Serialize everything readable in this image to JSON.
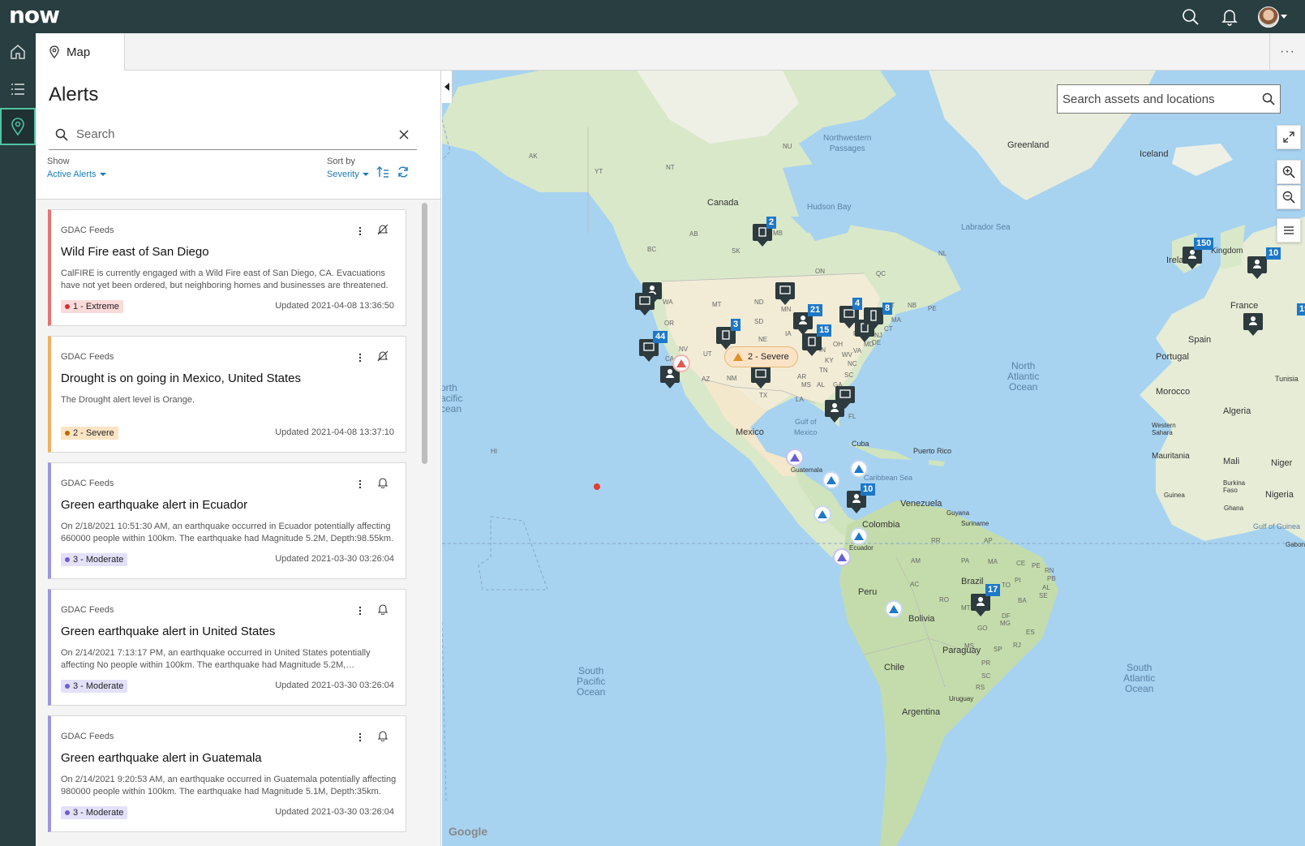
{
  "app": {
    "logo_text": "now",
    "tab_label": "Map",
    "tab_more": "···"
  },
  "panel": {
    "title": "Alerts",
    "search_placeholder": "Search",
    "show_label": "Show",
    "show_value": "Active Alerts",
    "sort_label": "Sort by",
    "sort_value": "Severity"
  },
  "alerts": [
    {
      "source": "GDAC Feeds",
      "title": "Wild Fire east of San Diego",
      "description": "CalFIRE is currently engaged with a Wild Fire east of San Diego, CA. Evacuations have not yet been ordered, but neighboring homes and businesses are threatened. Plea…",
      "severity": "1 - Extreme",
      "updated": "Updated 2021-04-08 13:36:50",
      "action_icon": "bell-off-icon",
      "color": "#e57373",
      "badge_bg": "#fbdada",
      "dot": "#d32f2f"
    },
    {
      "source": "GDAC Feeds",
      "title": "Drought is on going in Mexico, United States",
      "description": "The Drought alert level is Orange.",
      "severity": "2 - Severe",
      "updated": "Updated 2021-04-08 13:37:10",
      "action_icon": "bell-off-icon",
      "color": "#f0b060",
      "badge_bg": "#fde4c4",
      "dot": "#b86b00"
    },
    {
      "source": "GDAC Feeds",
      "title": "Green earthquake alert in Ecuador",
      "description": "On 2/18/2021 10:51:30 AM, an earthquake occurred in Ecuador potentially affecting 660000 people within 100km. The earthquake had Magnitude 5.2M, Depth:98.55km.",
      "severity": "3 - Moderate",
      "updated": "Updated 2021-03-30 03:26:04",
      "action_icon": "bell-icon",
      "color": "#9d96e0",
      "badge_bg": "#e3e0fa",
      "dot": "#6a5fd0"
    },
    {
      "source": "GDAC Feeds",
      "title": "Green earthquake alert in United States",
      "description": "On 2/14/2021 7:13:17 PM, an earthquake occurred in United States potentially affecting No people within 100km. The earthquake had Magnitude 5.2M,…",
      "severity": "3 - Moderate",
      "updated": "Updated 2021-03-30 03:26:04",
      "action_icon": "bell-icon",
      "color": "#9d96e0",
      "badge_bg": "#e3e0fa",
      "dot": "#6a5fd0"
    },
    {
      "source": "GDAC Feeds",
      "title": "Green earthquake alert in Guatemala",
      "description": "On 2/14/2021 9:20:53 AM, an earthquake occurred in Guatemala potentially affecting 980000 people within 100km. The earthquake had Magnitude 5.1M, Depth:35km.",
      "severity": "3 - Moderate",
      "updated": "Updated 2021-03-30 03:26:04",
      "action_icon": "bell-icon",
      "color": "#9d96e0",
      "badge_bg": "#e3e0fa",
      "dot": "#6a5fd0"
    }
  ],
  "map": {
    "search_placeholder": "Search assets and locations",
    "severity_pill": "2 - Severe",
    "attribution": "Google",
    "labels": {
      "greenland": "Greenland",
      "iceland": "Iceland",
      "canada": "Canada",
      "hudson_bay": "Hudson Bay",
      "labrador_sea": "Labrador Sea",
      "northwestern_passages": "Northwestern\nPassages",
      "mexico": "Mexico",
      "gulf_of_mexico": "Gulf of\nMexico",
      "cuba": "Cuba",
      "puerto_rico": "Puerto Rico",
      "guatemala": "Guatemala",
      "caribbean_sea": "Caribbean Sea",
      "venezuela": "Venezuela",
      "guyana": "Guyana",
      "suriname": "Suriname",
      "colombia": "Colombia",
      "ecuador": "Ecuador",
      "peru": "Peru",
      "brazil": "Brazil",
      "bolivia": "Bolivia",
      "paraguay": "Paraguay",
      "chile": "Chile",
      "uruguay": "Uruguay",
      "argentina": "Argentina",
      "ireland": "Ireland",
      "kingdom": "Kingdom",
      "france": "France",
      "spain": "Spain",
      "portugal": "Portugal",
      "morocco": "Morocco",
      "algeria": "Algeria",
      "tunisia": "Tunisia",
      "western_sahara": "Western\nSahara",
      "mauritania": "Mauritania",
      "mali": "Mali",
      "niger": "Niger",
      "burkina_faso": "Burkina\nFaso",
      "guinea": "Guinea",
      "ghana": "Ghana",
      "nigeria": "Nigeria",
      "gulf_of_guinea": "Gulf of Guinea",
      "gabon": "Gabon",
      "north_atlantic": "North\nAtlantic\nOcean",
      "south_atlantic": "South\nAtlantic\nOcean",
      "south_pacific": "South\nPacific\nOcean",
      "north_pacific": "orth\nacific\ncean"
    },
    "states": [
      "NU",
      "NT",
      "YT",
      "AK",
      "BC",
      "AB",
      "SK",
      "MB",
      "ON",
      "QC",
      "NL",
      "NB",
      "PE",
      "WA",
      "OR",
      "CA",
      "NV",
      "UT",
      "MT",
      "ND",
      "SD",
      "NE",
      "KS",
      "OK",
      "TX",
      "NM",
      "AZ",
      "MN",
      "IA",
      "WI",
      "IL",
      "MI",
      "IN",
      "OH",
      "KY",
      "TN",
      "AR",
      "MS",
      "AL",
      "GA",
      "LA",
      "FL",
      "SC",
      "NC",
      "VA",
      "WV",
      "PA",
      "NY",
      "VT",
      "MA",
      "CT",
      "NJ",
      "MD",
      "DE",
      "HI",
      "AM",
      "PA",
      "MA",
      "CE",
      "PE",
      "RO",
      "AC",
      "MT",
      "GO",
      "MG",
      "RJ",
      "SP",
      "PR",
      "SC",
      "RS",
      "MS",
      "BA",
      "DF",
      "AP",
      "RR",
      "TO",
      "PI",
      "RN",
      "PB",
      "AL",
      "SE",
      "ES"
    ],
    "counts": [
      "2",
      "150",
      "10",
      "44",
      "3",
      "21",
      "15",
      "4",
      "8",
      "19",
      "10",
      "17"
    ]
  }
}
